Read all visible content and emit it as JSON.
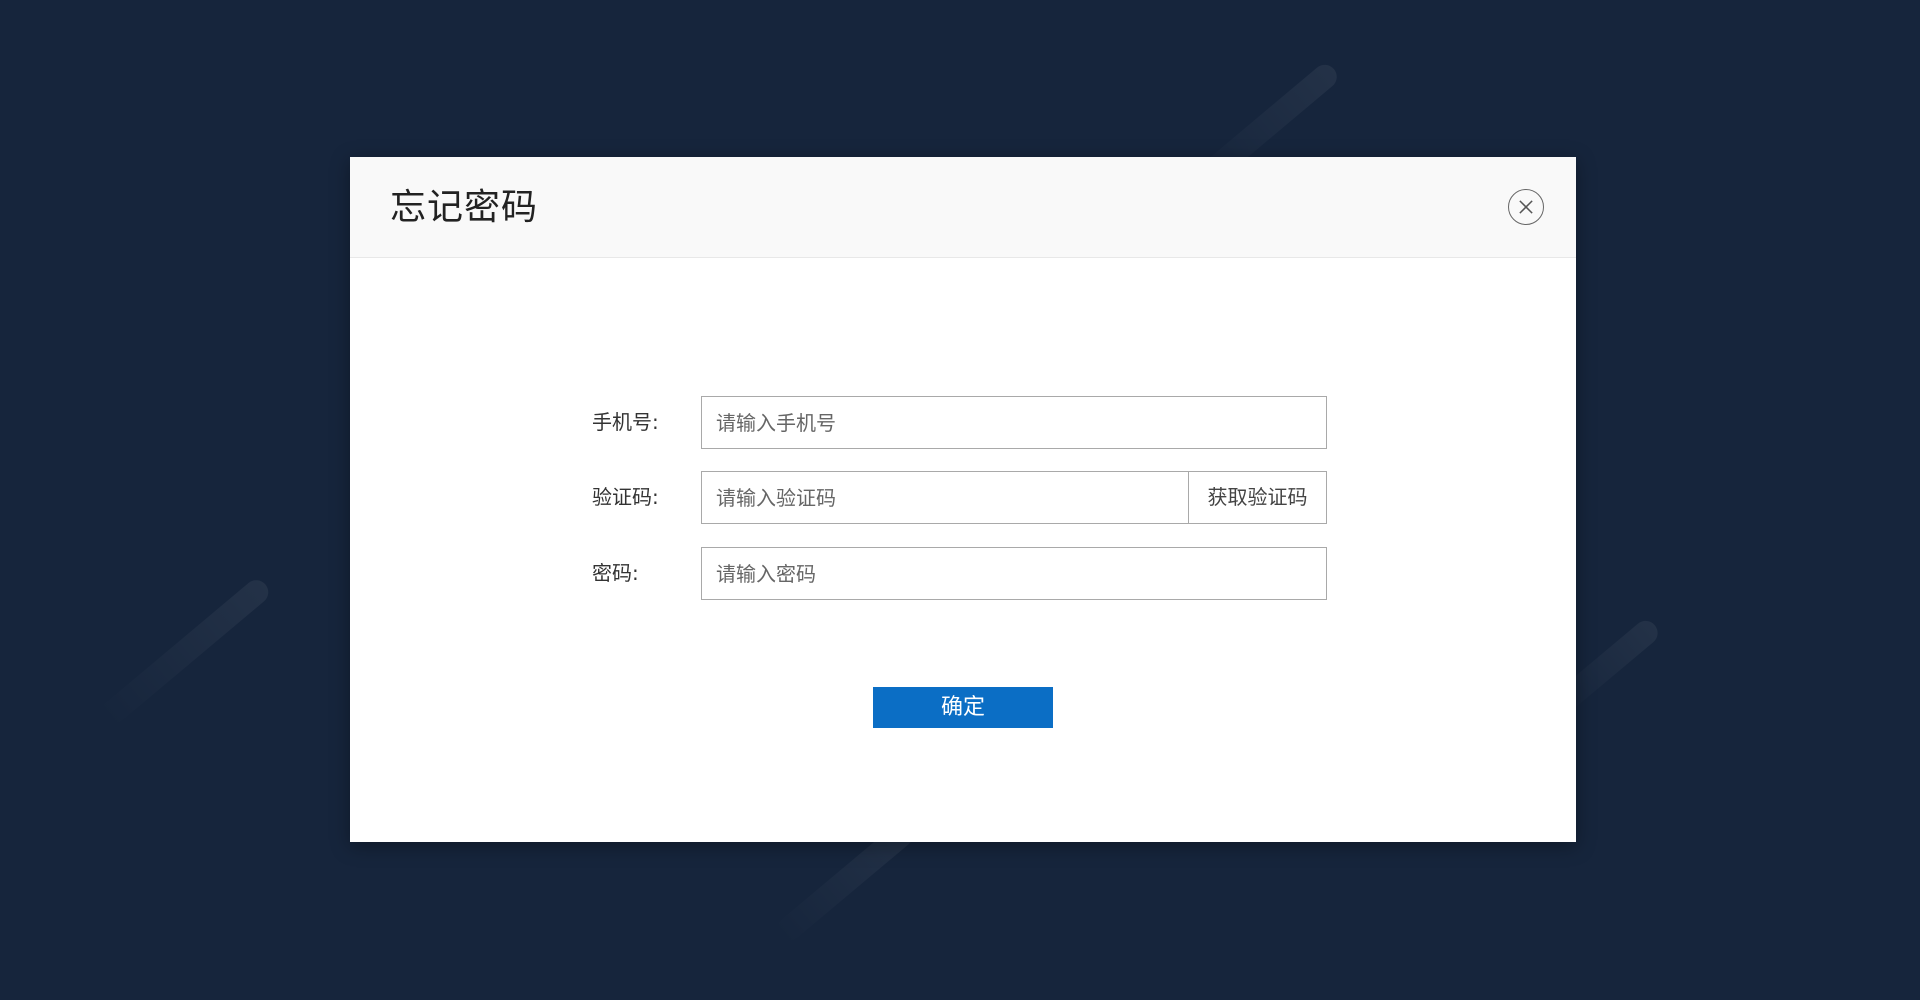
{
  "dialog": {
    "title": "忘记密码",
    "close_icon": "close-circle-icon"
  },
  "form": {
    "phone": {
      "label": "手机号:",
      "placeholder": "请输入手机号",
      "value": ""
    },
    "code": {
      "label": "验证码:",
      "placeholder": "请输入验证码",
      "value": "",
      "get_code_label": "获取验证码"
    },
    "password": {
      "label": "密码:",
      "placeholder": "请输入密码",
      "value": ""
    },
    "submit_label": "确定"
  },
  "colors": {
    "background": "#16253c",
    "primary_button": "#0b6ec5",
    "header_background": "#f9f9f9"
  }
}
